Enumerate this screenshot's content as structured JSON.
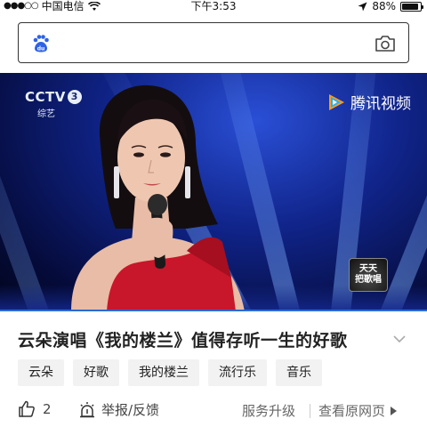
{
  "status_bar": {
    "carrier": "中国电信",
    "time": "下午3:53",
    "battery": "88%",
    "battery_level": 0.88
  },
  "search": {
    "placeholder": "",
    "left_icon": "baidu-paw-icon",
    "right_icon": "camera-icon"
  },
  "video": {
    "channel_logo": "CCTV",
    "channel_number": "3",
    "channel_sub": "综艺",
    "watermark": "腾讯视频",
    "show_logo_top": "天天",
    "show_logo_bottom": "把歌唱"
  },
  "article": {
    "title": "云朵演唱《我的楼兰》值得存听一生的好歌",
    "tags": [
      "云朵",
      "好歌",
      "我的楼兰",
      "流行乐",
      "音乐"
    ]
  },
  "actions": {
    "like_count": "2",
    "report_label": "举报/反馈",
    "service_label": "服务升级",
    "view_original_label": "查看原网页"
  },
  "colors": {
    "accent": "#2a6bd6",
    "tag_bg": "#f2f2f2",
    "video_bg": "#10248a"
  }
}
